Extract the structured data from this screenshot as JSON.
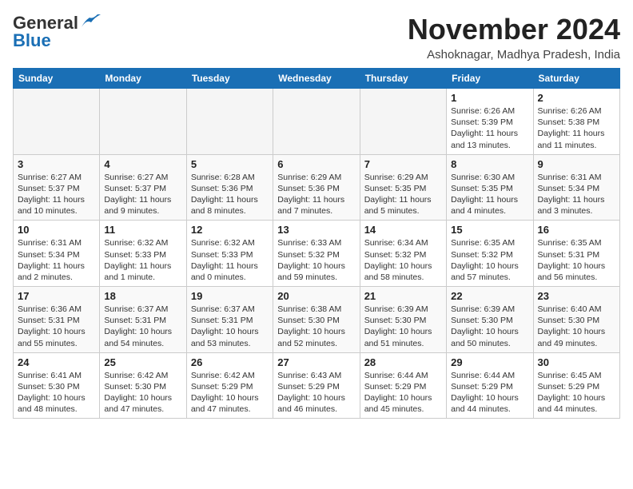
{
  "logo": {
    "line1": "General",
    "line2": "Blue"
  },
  "title": "November 2024",
  "location": "Ashoknagar, Madhya Pradesh, India",
  "days_of_week": [
    "Sunday",
    "Monday",
    "Tuesday",
    "Wednesday",
    "Thursday",
    "Friday",
    "Saturday"
  ],
  "weeks": [
    [
      {
        "day": "",
        "info": ""
      },
      {
        "day": "",
        "info": ""
      },
      {
        "day": "",
        "info": ""
      },
      {
        "day": "",
        "info": ""
      },
      {
        "day": "",
        "info": ""
      },
      {
        "day": "1",
        "info": "Sunrise: 6:26 AM\nSunset: 5:39 PM\nDaylight: 11 hours and 13 minutes."
      },
      {
        "day": "2",
        "info": "Sunrise: 6:26 AM\nSunset: 5:38 PM\nDaylight: 11 hours and 11 minutes."
      }
    ],
    [
      {
        "day": "3",
        "info": "Sunrise: 6:27 AM\nSunset: 5:37 PM\nDaylight: 11 hours and 10 minutes."
      },
      {
        "day": "4",
        "info": "Sunrise: 6:27 AM\nSunset: 5:37 PM\nDaylight: 11 hours and 9 minutes."
      },
      {
        "day": "5",
        "info": "Sunrise: 6:28 AM\nSunset: 5:36 PM\nDaylight: 11 hours and 8 minutes."
      },
      {
        "day": "6",
        "info": "Sunrise: 6:29 AM\nSunset: 5:36 PM\nDaylight: 11 hours and 7 minutes."
      },
      {
        "day": "7",
        "info": "Sunrise: 6:29 AM\nSunset: 5:35 PM\nDaylight: 11 hours and 5 minutes."
      },
      {
        "day": "8",
        "info": "Sunrise: 6:30 AM\nSunset: 5:35 PM\nDaylight: 11 hours and 4 minutes."
      },
      {
        "day": "9",
        "info": "Sunrise: 6:31 AM\nSunset: 5:34 PM\nDaylight: 11 hours and 3 minutes."
      }
    ],
    [
      {
        "day": "10",
        "info": "Sunrise: 6:31 AM\nSunset: 5:34 PM\nDaylight: 11 hours and 2 minutes."
      },
      {
        "day": "11",
        "info": "Sunrise: 6:32 AM\nSunset: 5:33 PM\nDaylight: 11 hours and 1 minute."
      },
      {
        "day": "12",
        "info": "Sunrise: 6:32 AM\nSunset: 5:33 PM\nDaylight: 11 hours and 0 minutes."
      },
      {
        "day": "13",
        "info": "Sunrise: 6:33 AM\nSunset: 5:32 PM\nDaylight: 10 hours and 59 minutes."
      },
      {
        "day": "14",
        "info": "Sunrise: 6:34 AM\nSunset: 5:32 PM\nDaylight: 10 hours and 58 minutes."
      },
      {
        "day": "15",
        "info": "Sunrise: 6:35 AM\nSunset: 5:32 PM\nDaylight: 10 hours and 57 minutes."
      },
      {
        "day": "16",
        "info": "Sunrise: 6:35 AM\nSunset: 5:31 PM\nDaylight: 10 hours and 56 minutes."
      }
    ],
    [
      {
        "day": "17",
        "info": "Sunrise: 6:36 AM\nSunset: 5:31 PM\nDaylight: 10 hours and 55 minutes."
      },
      {
        "day": "18",
        "info": "Sunrise: 6:37 AM\nSunset: 5:31 PM\nDaylight: 10 hours and 54 minutes."
      },
      {
        "day": "19",
        "info": "Sunrise: 6:37 AM\nSunset: 5:31 PM\nDaylight: 10 hours and 53 minutes."
      },
      {
        "day": "20",
        "info": "Sunrise: 6:38 AM\nSunset: 5:30 PM\nDaylight: 10 hours and 52 minutes."
      },
      {
        "day": "21",
        "info": "Sunrise: 6:39 AM\nSunset: 5:30 PM\nDaylight: 10 hours and 51 minutes."
      },
      {
        "day": "22",
        "info": "Sunrise: 6:39 AM\nSunset: 5:30 PM\nDaylight: 10 hours and 50 minutes."
      },
      {
        "day": "23",
        "info": "Sunrise: 6:40 AM\nSunset: 5:30 PM\nDaylight: 10 hours and 49 minutes."
      }
    ],
    [
      {
        "day": "24",
        "info": "Sunrise: 6:41 AM\nSunset: 5:30 PM\nDaylight: 10 hours and 48 minutes."
      },
      {
        "day": "25",
        "info": "Sunrise: 6:42 AM\nSunset: 5:30 PM\nDaylight: 10 hours and 47 minutes."
      },
      {
        "day": "26",
        "info": "Sunrise: 6:42 AM\nSunset: 5:29 PM\nDaylight: 10 hours and 47 minutes."
      },
      {
        "day": "27",
        "info": "Sunrise: 6:43 AM\nSunset: 5:29 PM\nDaylight: 10 hours and 46 minutes."
      },
      {
        "day": "28",
        "info": "Sunrise: 6:44 AM\nSunset: 5:29 PM\nDaylight: 10 hours and 45 minutes."
      },
      {
        "day": "29",
        "info": "Sunrise: 6:44 AM\nSunset: 5:29 PM\nDaylight: 10 hours and 44 minutes."
      },
      {
        "day": "30",
        "info": "Sunrise: 6:45 AM\nSunset: 5:29 PM\nDaylight: 10 hours and 44 minutes."
      }
    ]
  ]
}
